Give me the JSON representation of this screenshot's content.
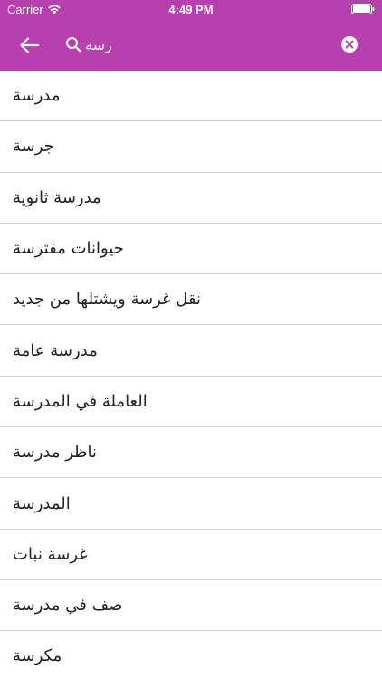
{
  "status_bar": {
    "carrier": "Carrier",
    "time": "4:49 PM"
  },
  "header": {
    "search": {
      "value": "رسة"
    }
  },
  "colors": {
    "header_bg": "#b83fae",
    "text": "#222222",
    "divider": "#d4d4d4"
  },
  "results": [
    "مدرسة",
    "جرسة",
    "مدرسة ثانوية",
    "حيوانات مفترسة",
    "نقل غرسة ويشتلها من جديد",
    "مدرسة عامة",
    "العاملة في المدرسة",
    "ناظر مدرسة",
    "المدرسة",
    "غرسة نبات",
    "صف في مدرسة",
    "مكرسة"
  ]
}
